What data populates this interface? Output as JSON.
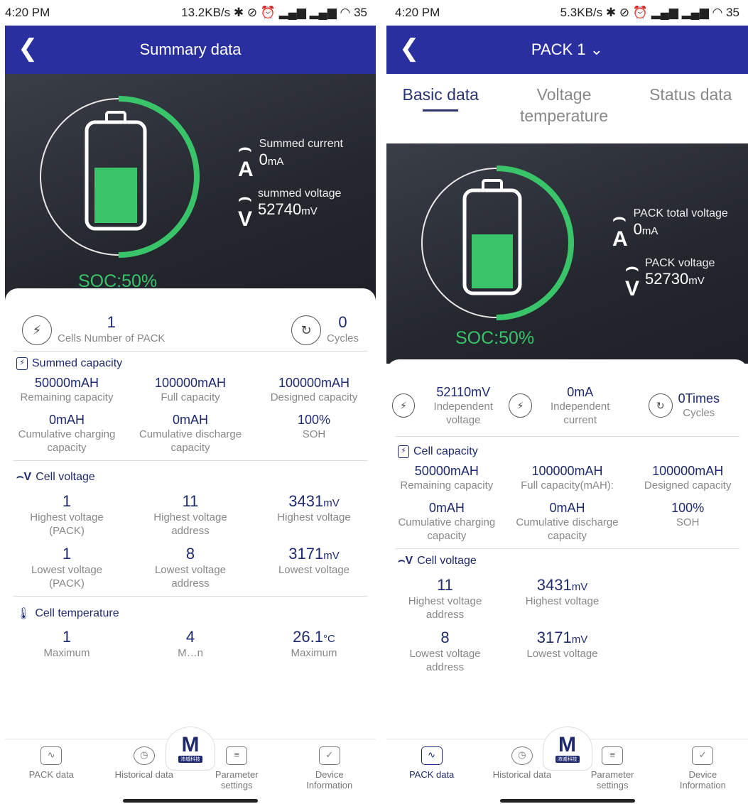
{
  "left": {
    "status": {
      "time": "4:20 PM",
      "indicators": "13.2KB/s ✱ ⊘ ⏰ ▂▄▆ ▂▄▆ ◠ 35"
    },
    "title": "Summary data",
    "soc": "SOC:50%",
    "metric1": {
      "label": "Summed current",
      "value": "0",
      "unit": "mA"
    },
    "metric2": {
      "label": "summed voltage",
      "value": "52740",
      "unit": "mV"
    },
    "cells_value": "1",
    "cells_label": "Cells Number of PACK",
    "cycles_value": "0",
    "cycles_label": "Cycles",
    "cap_title": "Summed capacity",
    "cap": [
      {
        "v": "50000mAH",
        "l": "Remaining capacity"
      },
      {
        "v": "100000mAH",
        "l": "Full capacity"
      },
      {
        "v": "100000mAH",
        "l": "Designed capacity"
      },
      {
        "v": "0mAH",
        "l": "Cumulative charging capacity"
      },
      {
        "v": "0mAH",
        "l": "Cumulative discharge capacity"
      },
      {
        "v": "100%",
        "l": "SOH"
      }
    ],
    "volt_title": "Cell voltage",
    "volt": [
      {
        "v": "1",
        "l": "Highest voltage (PACK)"
      },
      {
        "v": "11",
        "l": "Highest voltage address"
      },
      {
        "v": "3431",
        "u": "mV",
        "l": "Highest voltage"
      },
      {
        "v": "1",
        "l": "Lowest voltage (PACK)"
      },
      {
        "v": "8",
        "l": "Lowest voltage address"
      },
      {
        "v": "3171",
        "u": "mV",
        "l": "Lowest voltage"
      }
    ],
    "temp_title": "Cell temperature",
    "temp": [
      {
        "v": "1",
        "l": "Maximum"
      },
      {
        "v": "4",
        "l": "M…n"
      },
      {
        "v": "26.1",
        "u": "°C",
        "l": "Maximum"
      }
    ]
  },
  "right": {
    "status": {
      "time": "4:20 PM",
      "indicators": "5.3KB/s ✱ ⊘ ⏰ ▂▄▆ ▂▄▆ ◠ 35"
    },
    "title": "PACK 1 ⌄",
    "tabs": [
      "Basic data",
      "Voltage temperature",
      "Status data"
    ],
    "soc": "SOC:50%",
    "metric1": {
      "label": "PACK total voltage",
      "value": "0",
      "unit": "mA"
    },
    "metric2": {
      "label": "PACK voltage",
      "value": "52730",
      "unit": "mV"
    },
    "top": [
      {
        "v": "52110mV",
        "l": "Independent voltage"
      },
      {
        "v": "0mA",
        "l": "Independent current"
      },
      {
        "v": "0Times",
        "l": "Cycles"
      }
    ],
    "cap_title": "Cell capacity",
    "cap": [
      {
        "v": "50000mAH",
        "l": "Remaining capacity"
      },
      {
        "v": "100000mAH",
        "l": "Full capacity(mAH):"
      },
      {
        "v": "100000mAH",
        "l": "Designed capacity"
      },
      {
        "v": "0mAH",
        "l": "Cumulative charging capacity"
      },
      {
        "v": "0mAH",
        "l": "Cumulative discharge capacity"
      },
      {
        "v": "100%",
        "l": "SOH"
      }
    ],
    "volt_title": "Cell voltage",
    "volt": [
      {
        "v": "11",
        "l": "Highest voltage address"
      },
      {
        "v": "3431",
        "u": "mV",
        "l": "Highest voltage"
      },
      {
        "v": "8",
        "l": "Lowest voltage address"
      },
      {
        "v": "3171",
        "u": "mV",
        "l": "Lowest voltage"
      }
    ]
  },
  "nav": {
    "pack": "PACK data",
    "hist": "Historical data",
    "param": "Parameter settings",
    "device": "Device Information",
    "logo_sub": "沛城科技"
  },
  "soc_level": 0.5,
  "colors": {
    "brand": "#2a2fa0",
    "accent": "#3ac46a",
    "text_blue": "#1f2a6e"
  }
}
